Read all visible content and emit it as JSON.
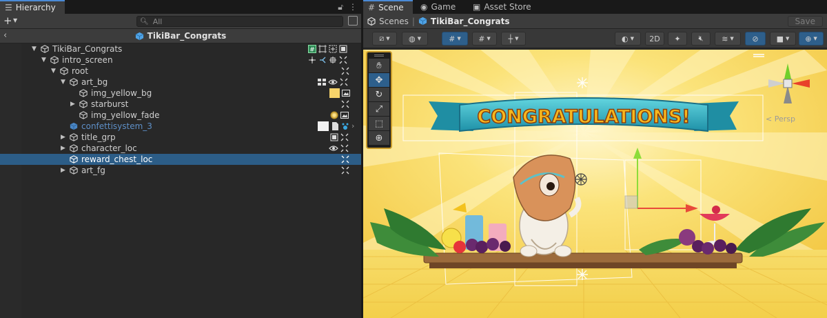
{
  "hierarchy": {
    "tab_label": "Hierarchy",
    "search_placeholder": "All",
    "scene_name": "TikiBar_Congrats",
    "rows": [
      {
        "label": "TikiBar_Congrats",
        "depth": 0,
        "arrow": "down",
        "selected": false,
        "color": "normal"
      },
      {
        "label": "intro_screen",
        "depth": 1,
        "arrow": "down",
        "selected": false,
        "color": "normal"
      },
      {
        "label": "root",
        "depth": 2,
        "arrow": "down",
        "selected": false,
        "color": "normal"
      },
      {
        "label": "art_bg",
        "depth": 3,
        "arrow": "down",
        "selected": false,
        "color": "normal"
      },
      {
        "label": "img_yellow_bg",
        "depth": 4,
        "arrow": "none",
        "selected": false,
        "color": "normal"
      },
      {
        "label": "starburst",
        "depth": 4,
        "arrow": "right",
        "selected": false,
        "color": "normal"
      },
      {
        "label": "img_yellow_fade",
        "depth": 4,
        "arrow": "none",
        "selected": false,
        "color": "normal"
      },
      {
        "label": "confettisystem_3",
        "depth": 3,
        "arrow": "none",
        "selected": false,
        "color": "blue"
      },
      {
        "label": "title_grp",
        "depth": 3,
        "arrow": "right",
        "selected": false,
        "color": "normal"
      },
      {
        "label": "character_loc",
        "depth": 3,
        "arrow": "right",
        "selected": false,
        "color": "normal"
      },
      {
        "label": "reward_chest_loc",
        "depth": 3,
        "arrow": "none",
        "selected": true,
        "color": "normal"
      },
      {
        "label": "art_fg",
        "depth": 3,
        "arrow": "right",
        "selected": false,
        "color": "normal"
      }
    ]
  },
  "scene": {
    "tabs": [
      {
        "label": "Scene",
        "icon": "grid-icon",
        "active": true
      },
      {
        "label": "Game",
        "icon": "gamepad-icon",
        "active": false
      },
      {
        "label": "Asset Store",
        "icon": "bag-icon",
        "active": false
      }
    ],
    "breadcrumb": [
      "Scenes",
      "TikiBar_Congrats"
    ],
    "save_label": "Save",
    "mode_2d_label": "2D",
    "persp_label": "< Persp",
    "banner_text": "CONGRATULATIONS!"
  },
  "colors": {
    "selection": "#2c5d87",
    "accent": "#4a8ad6",
    "banner": "#33b7c9",
    "banner_text": "#f5b21c",
    "background_yellow": "#f7d64f"
  }
}
